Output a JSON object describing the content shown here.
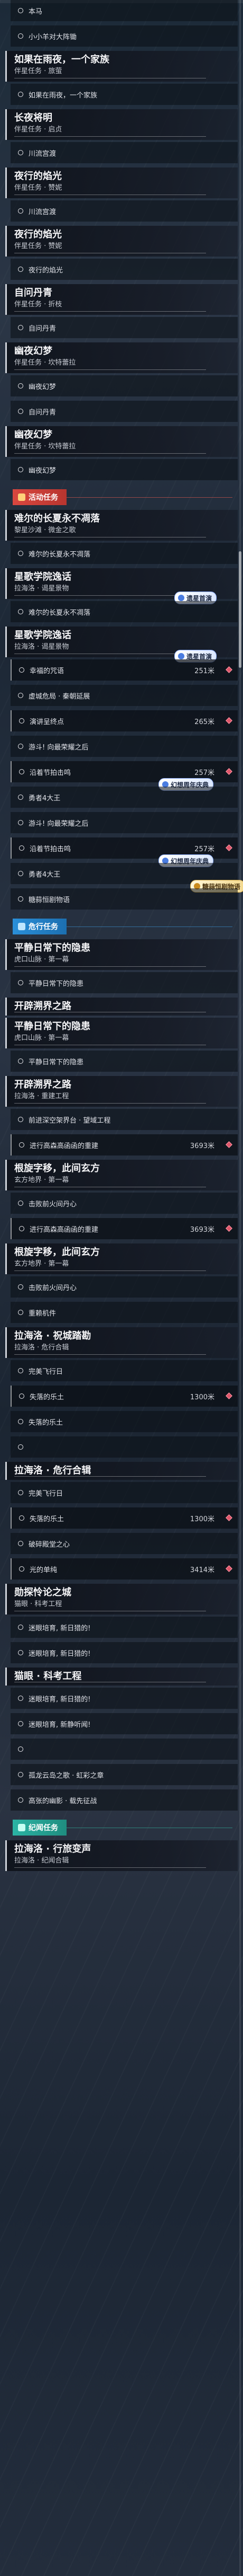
{
  "categories": {
    "event": "活动任务",
    "danger": "危行任务",
    "daily": "纪闻任务"
  },
  "badges": {
    "event_a": "遗星首演",
    "event_b": "遗星首演",
    "event_c": "幻想周年庆典",
    "event_d": "幻想周年庆典",
    "event_e": "糖蒜恒剧物语"
  },
  "items": [
    {
      "kind": "obj",
      "text": "本马",
      "dist": "",
      "marker": false
    },
    {
      "kind": "obj",
      "text": "小小羊对大阵锄",
      "dist": "",
      "marker": false
    },
    {
      "kind": "task",
      "title": "如果在雨夜，一个家族",
      "sub": "伴星任务 · 旅萤",
      "trunc": false
    },
    {
      "kind": "obj",
      "text": "如果在雨夜，一个家族",
      "dist": "",
      "marker": false
    },
    {
      "kind": "task",
      "title": "长夜将明",
      "sub": "伴星任务 · 启贞",
      "trunc": false
    },
    {
      "kind": "obj",
      "text": "川流宫渡",
      "dist": "",
      "marker": false
    },
    {
      "kind": "task",
      "title": "夜行的焰光",
      "sub": "伴星任务 · 赞妮",
      "trunc": false
    },
    {
      "kind": "obj",
      "text": "川流宫渡",
      "dist": "",
      "marker": false
    },
    {
      "kind": "task",
      "title": "夜行的焰光",
      "sub": "伴星任务 · 赞妮",
      "trunc": false
    },
    {
      "kind": "obj",
      "text": "夜行的焰光",
      "dist": "",
      "marker": false
    },
    {
      "kind": "task",
      "title": "自问丹青",
      "sub": "伴星任务 · 折枝",
      "trunc": false
    },
    {
      "kind": "obj",
      "text": "自问丹青",
      "dist": "",
      "marker": false
    },
    {
      "kind": "task",
      "title": "幽夜幻梦",
      "sub": "伴星任务 · 坎特蕾拉",
      "trunc": false
    },
    {
      "kind": "obj",
      "text": "幽夜幻梦",
      "dist": "",
      "marker": false
    },
    {
      "kind": "obj",
      "text": "自问丹青",
      "dist": "",
      "marker": false
    },
    {
      "kind": "task",
      "title": "幽夜幻梦",
      "sub": "伴星任务 · 坎特蕾拉",
      "trunc": false
    },
    {
      "kind": "obj",
      "text": "幽夜幻梦",
      "dist": "",
      "marker": false
    },
    {
      "kind": "cat",
      "cat": "event"
    },
    {
      "kind": "task",
      "title": "难尔的长夏永不凋落",
      "sub": "黎星沙滩 · 微金之歌",
      "trunc": false
    },
    {
      "kind": "obj",
      "text": "难尔的长夏永不凋落",
      "dist": "",
      "marker": false
    },
    {
      "kind": "task",
      "title": "星歌学院逸话",
      "sub": "拉海洛 · 谒星景物",
      "trunc": false,
      "badge": "event_a"
    },
    {
      "kind": "obj",
      "text": "难尔的长夏永不凋落",
      "dist": "",
      "marker": false
    },
    {
      "kind": "task",
      "title": "星歌学院逸话",
      "sub": "拉海洛 · 谒星景物",
      "trunc": false,
      "badge": "event_b"
    },
    {
      "kind": "obj",
      "text": "幸福的咒语",
      "dist": "251米",
      "marker": true
    },
    {
      "kind": "obj",
      "text": "虚城危局 · 秦朝延展",
      "dist": "",
      "marker": false
    },
    {
      "kind": "obj",
      "text": "演讲呈终点",
      "dist": "265米",
      "marker": true
    },
    {
      "kind": "obj",
      "text": "游斗! 向最荣耀之后",
      "dist": "",
      "marker": false
    },
    {
      "kind": "obj",
      "text": "沿着节拍击鸣",
      "dist": "257米",
      "marker": true,
      "badge": "event_c"
    },
    {
      "kind": "obj",
      "text": "勇者4大王",
      "dist": "",
      "marker": false
    },
    {
      "kind": "obj",
      "text": "游斗! 向最荣耀之后",
      "dist": "",
      "marker": false
    },
    {
      "kind": "obj",
      "text": "沿着节拍击鸣",
      "dist": "257米",
      "marker": true,
      "badge": "event_d"
    },
    {
      "kind": "obj",
      "text": "勇者4大王",
      "dist": "",
      "marker": false,
      "badge": "event_e"
    },
    {
      "kind": "obj",
      "text": "糖蒜恒剧物语",
      "dist": "",
      "marker": false
    },
    {
      "kind": "cat",
      "cat": "danger"
    },
    {
      "kind": "task",
      "title": "平静日常下的隐患",
      "sub": "虎口山脉 · 第一幕",
      "trunc": false
    },
    {
      "kind": "obj",
      "text": "平静日常下的隐患",
      "dist": "",
      "marker": false
    },
    {
      "kind": "task",
      "title": "开辟溯界之路",
      "sub": "",
      "trunc": true
    },
    {
      "kind": "task",
      "title": "平静日常下的隐患",
      "sub": "虎口山脉 · 第一幕",
      "trunc": false
    },
    {
      "kind": "obj",
      "text": "平静日常下的隐患",
      "dist": "",
      "marker": false
    },
    {
      "kind": "task",
      "title": "开辟溯界之路",
      "sub": "拉海洛 · 重建工程",
      "trunc": false
    },
    {
      "kind": "obj",
      "text": "前进深空架界台 · 望域工程",
      "dist": "",
      "marker": false
    },
    {
      "kind": "obj",
      "text": "进行高森高函函的重建",
      "dist": "3693米",
      "marker": true
    },
    {
      "kind": "task",
      "title": "根旋字移，此间玄方",
      "sub": "玄方地界 · 第一幕",
      "trunc": false
    },
    {
      "kind": "obj",
      "text": "击败前火间丹心",
      "dist": "",
      "marker": false
    },
    {
      "kind": "obj",
      "text": "进行高森高函函的重建",
      "dist": "3693米",
      "marker": true
    },
    {
      "kind": "task",
      "title": "根旋字移，此间玄方",
      "sub": "玄方地界 · 第一幕",
      "trunc": false
    },
    {
      "kind": "obj",
      "text": "击败前火间丹心",
      "dist": "",
      "marker": false
    },
    {
      "kind": "obj",
      "text": "重赖机件",
      "dist": "",
      "marker": false
    },
    {
      "kind": "task",
      "title": "拉海洛 · 祝城踏勘",
      "sub": "拉海洛 · 危行合辑",
      "trunc": false
    },
    {
      "kind": "obj",
      "text": "完美飞行日",
      "dist": "",
      "marker": false
    },
    {
      "kind": "obj",
      "text": "失落的乐土",
      "dist": "1300米",
      "marker": true
    },
    {
      "kind": "obj",
      "text": "失落的乐土",
      "dist": "",
      "marker": false
    },
    {
      "kind": "obj",
      "text": "",
      "dist": "",
      "marker": false
    },
    {
      "kind": "task",
      "title": "拉海洛 · 危行合辑",
      "sub": "",
      "trunc": true
    },
    {
      "kind": "obj",
      "text": "完美飞行日",
      "dist": "",
      "marker": false
    },
    {
      "kind": "obj",
      "text": "失落的乐土",
      "dist": "1300米",
      "marker": true
    },
    {
      "kind": "obj",
      "text": "破碎殿堂之心",
      "dist": "",
      "marker": false
    },
    {
      "kind": "obj",
      "text": "光的单纯",
      "dist": "3414米",
      "marker": true
    },
    {
      "kind": "task",
      "title": "勋探怜论之城",
      "sub": "猫眼 · 科考工程",
      "trunc": false
    },
    {
      "kind": "obj",
      "text": "迷眼培育, 新日猎的!",
      "dist": "",
      "marker": false
    },
    {
      "kind": "obj",
      "text": "迷眼培育, 新日猎的!",
      "dist": "",
      "marker": false
    },
    {
      "kind": "task",
      "title": "猫眼 · 科考工程",
      "sub": "",
      "trunc": true
    },
    {
      "kind": "obj",
      "text": "迷眼培育, 新日猎的!",
      "dist": "",
      "marker": false
    },
    {
      "kind": "obj",
      "text": "迷眼培育, 新静听闻!",
      "dist": "",
      "marker": false
    },
    {
      "kind": "obj",
      "text": "",
      "dist": "",
      "marker": false
    },
    {
      "kind": "obj",
      "text": "孤龙云岛之歌 · 虹彩之章",
      "dist": "",
      "marker": false
    },
    {
      "kind": "obj",
      "text": "高张的幽影 · 载先征战",
      "dist": "",
      "marker": false
    },
    {
      "kind": "cat",
      "cat": "daily"
    },
    {
      "kind": "task",
      "title": "拉海洛 · 行旅变声",
      "sub": "拉海洛 · 纪闻合辑",
      "trunc": false
    }
  ]
}
